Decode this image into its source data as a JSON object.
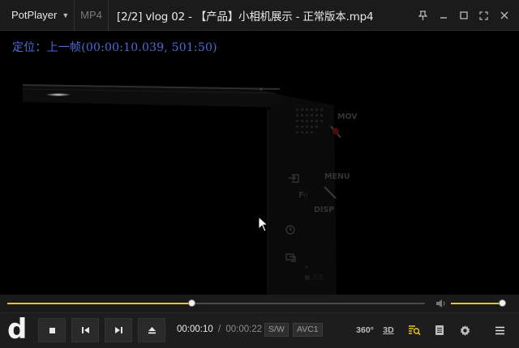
{
  "titlebar": {
    "app_name": "PotPlayer",
    "format_label": "MP4",
    "title": "[2/2] vlog 02 - 【产品】小相机展示 - 正常版本.mp4"
  },
  "osd": {
    "text": "定位：上一帧(00:00:10.039, 501:50)"
  },
  "playback": {
    "seek_progress": 0.44,
    "volume_level": 0.95
  },
  "controls": {
    "logo_text": "d",
    "current_time": "00:00:10",
    "separator": "/",
    "duration": "00:00:22",
    "decoder_badge": "S/W",
    "codec_badge": "AVC1",
    "vr_label": "360°",
    "3d_label": "3D"
  },
  "video_overlay": {
    "menu_text": "MENU",
    "disp_text": "DISP",
    "mode_text": "MOV"
  },
  "colors": {
    "accent": "#e8c51a",
    "osd_text": "#4d6bd8"
  }
}
